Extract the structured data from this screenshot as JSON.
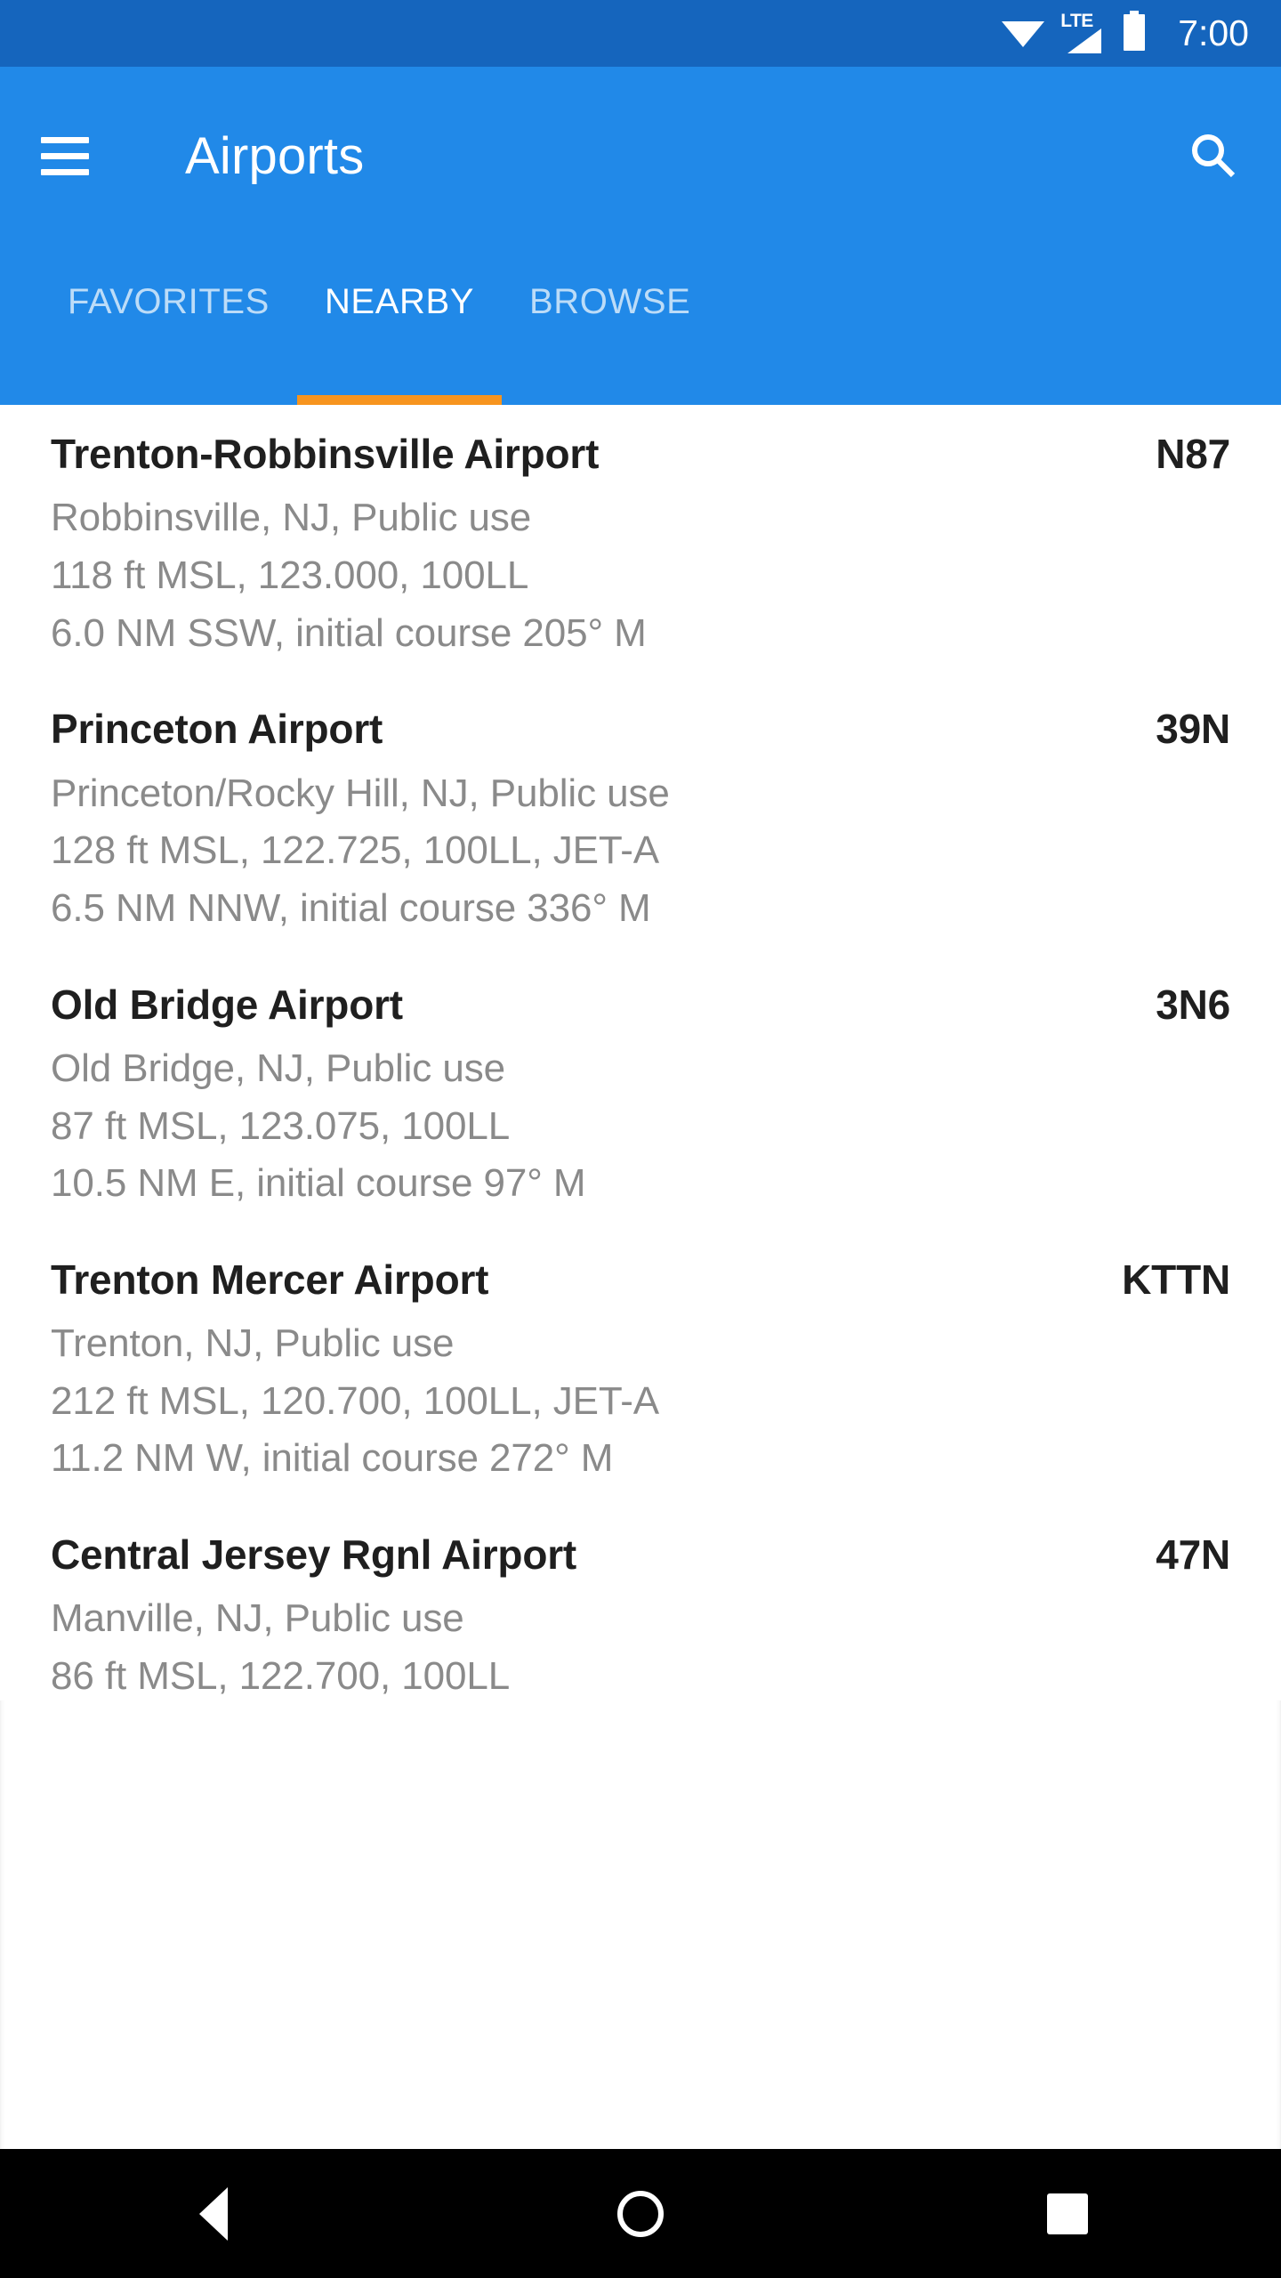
{
  "status_bar": {
    "network_label": "LTE",
    "time": "7:00",
    "icons": [
      "wifi-icon",
      "lte-signal-icon",
      "battery-icon"
    ],
    "background_color": "#1565bd",
    "foreground_color": "#ffffff"
  },
  "app_bar": {
    "title": "Airports",
    "menu_icon": "hamburger-menu-icon",
    "search_icon": "search-icon",
    "background_color": "#2189e8",
    "title_color": "#ffffff"
  },
  "tabs": {
    "items": [
      {
        "label": "FAVORITES",
        "active": false
      },
      {
        "label": "NEARBY",
        "active": true
      },
      {
        "label": "BROWSE",
        "active": false
      }
    ],
    "indicator_color": "#f7941e",
    "active_color": "#ffffff",
    "inactive_color": "#bcdcf8"
  },
  "list": {
    "items": [
      {
        "name": "Trenton-Robbinsville Airport",
        "code": "N87",
        "location": "Robbinsville, NJ, Public use",
        "specs": "118 ft MSL, 123.000, 100LL",
        "distance": "6.0 NM SSW, initial course 205° M"
      },
      {
        "name": "Princeton Airport",
        "code": "39N",
        "location": "Princeton/Rocky Hill, NJ, Public use",
        "specs": "128 ft MSL, 122.725, 100LL, JET-A",
        "distance": "6.5 NM NNW, initial course 336° M"
      },
      {
        "name": "Old Bridge Airport",
        "code": "3N6",
        "location": "Old Bridge, NJ, Public use",
        "specs": "87 ft MSL, 123.075, 100LL",
        "distance": "10.5 NM E, initial course 97° M"
      },
      {
        "name": "Trenton Mercer Airport",
        "code": "KTTN",
        "location": "Trenton, NJ, Public use",
        "specs": "212 ft MSL, 120.700, 100LL, JET-A",
        "distance": "11.2 NM W, initial course 272° M"
      },
      {
        "name": "Central Jersey Rgnl Airport",
        "code": "47N",
        "location": "Manville, NJ, Public use",
        "specs": "86 ft MSL, 122.700, 100LL",
        "distance": ""
      }
    ],
    "name_color": "#1f1f1f",
    "detail_color": "#8a8a8a",
    "background_color": "#ffffff"
  },
  "nav_bar": {
    "back_icon": "back-triangle-icon",
    "home_icon": "home-circle-icon",
    "recents_icon": "recents-square-icon",
    "background_color": "#000000"
  }
}
